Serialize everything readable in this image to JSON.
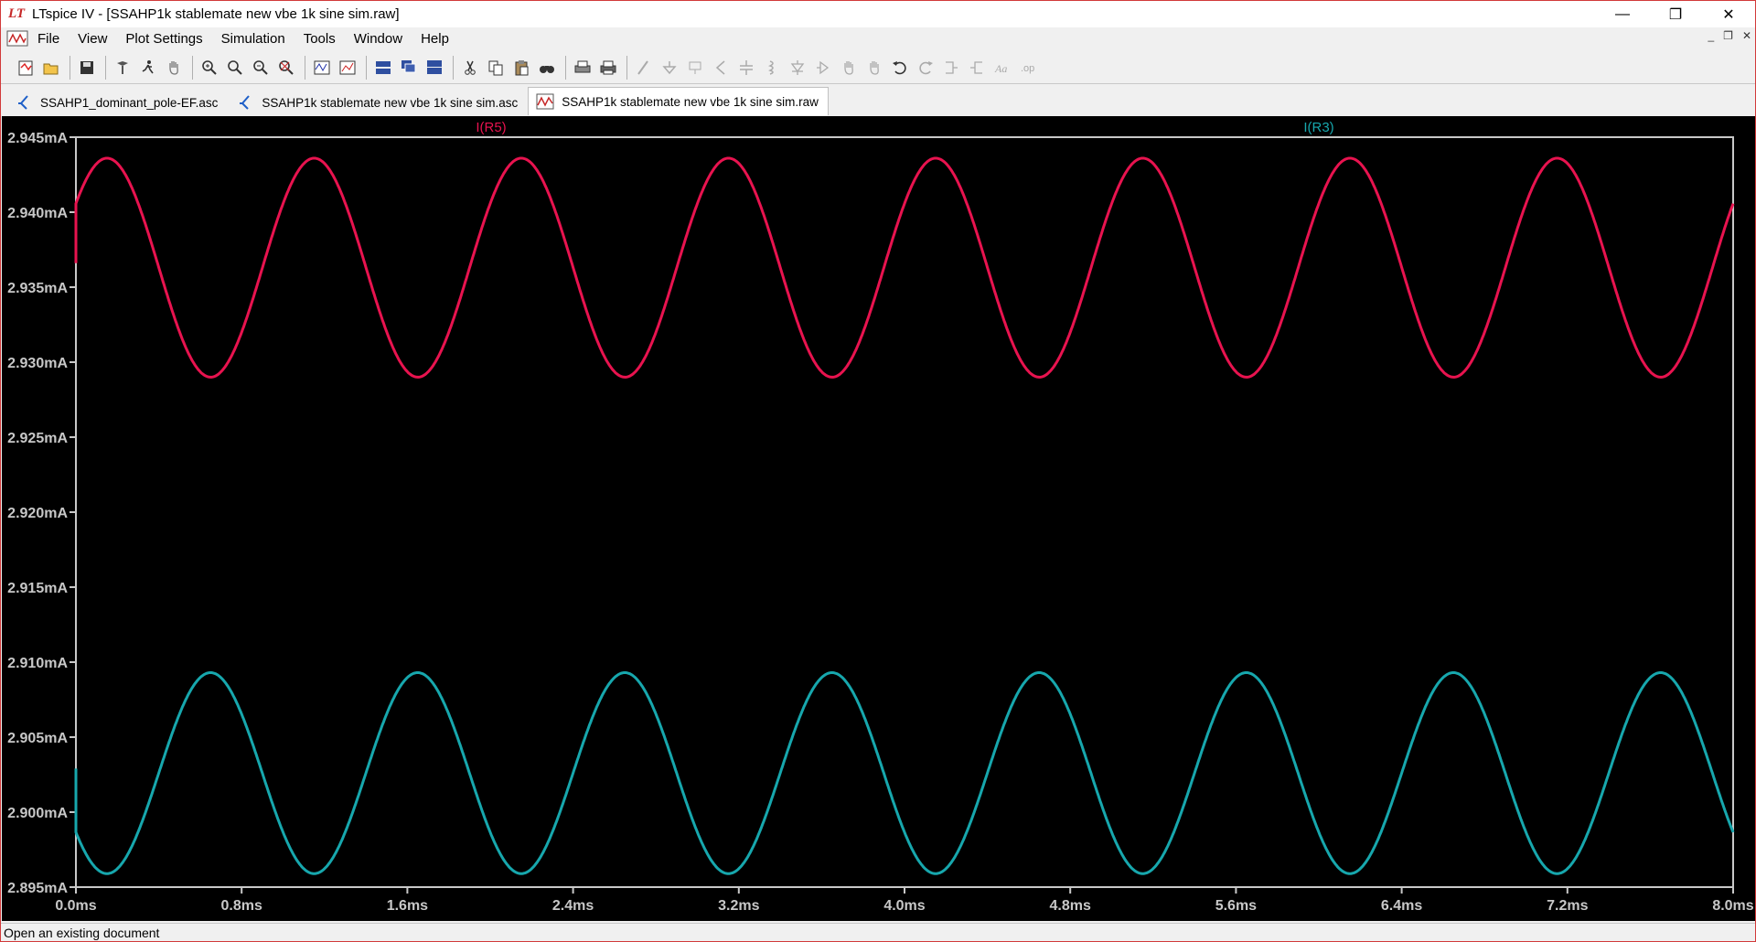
{
  "window": {
    "title": "LTspice IV - [SSAHP1k stablemate new vbe 1k sine sim.raw]",
    "app_logo_text": "LT",
    "minimize": "—",
    "maximize": "❐",
    "close": "✕"
  },
  "menu": {
    "items": [
      "File",
      "View",
      "Plot Settings",
      "Simulation",
      "Tools",
      "Window",
      "Help"
    ],
    "mdi_minimize": "_",
    "mdi_restore": "❐",
    "mdi_close": "✕"
  },
  "toolbar": {
    "icons": [
      "open-schematic-icon",
      "open-file-icon",
      "save-icon",
      "control-panel-icon",
      "run-icon",
      "pan-icon",
      "zoom-in-icon",
      "zoom-area-icon",
      "zoom-out-icon",
      "zoom-fit-icon",
      "autorange-icon",
      "add-trace-icon",
      "tile-horizontal-icon",
      "cascade-icon",
      "tile-windows-icon",
      "cut-icon",
      "copy-icon",
      "paste-icon",
      "find-icon",
      "print-preview-icon",
      "print-icon",
      "wire-icon",
      "ground-icon",
      "label-icon",
      "resistor-icon",
      "capacitor-icon",
      "inductor-icon",
      "diode-icon",
      "component-icon",
      "move-icon",
      "drag-icon",
      "undo-icon",
      "redo-icon",
      "rotate-icon",
      "mirror-icon",
      "text-icon",
      "spice-directive-icon"
    ]
  },
  "tabs": [
    {
      "label": "SSAHP1_dominant_pole-EF.asc",
      "icon": "schematic-icon",
      "active": false
    },
    {
      "label": "SSAHP1k stablemate new vbe 1k sine sim.asc",
      "icon": "schematic-icon",
      "active": false
    },
    {
      "label": "SSAHP1k stablemate new vbe 1k sine sim.raw",
      "icon": "waveform-icon",
      "active": true
    }
  ],
  "status": {
    "text": "Open an existing document"
  },
  "colors": {
    "plot_bg": "#000000",
    "axis": "#c8c8c8",
    "trace_r5": "#e8134f",
    "trace_r3": "#17a7ad"
  },
  "chart_data": {
    "type": "line",
    "title": "",
    "xlabel": "",
    "ylabel": "",
    "xlim": [
      0,
      8.0
    ],
    "ylim": [
      2.895,
      2.945
    ],
    "x_unit": "ms",
    "y_unit": "mA",
    "x_ticks": [
      "0.0ms",
      "0.8ms",
      "1.6ms",
      "2.4ms",
      "3.2ms",
      "4.0ms",
      "4.8ms",
      "5.6ms",
      "6.4ms",
      "7.2ms",
      "8.0ms"
    ],
    "y_ticks": [
      "2.945mA",
      "2.940mA",
      "2.935mA",
      "2.930mA",
      "2.925mA",
      "2.920mA",
      "2.915mA",
      "2.910mA",
      "2.905mA",
      "2.900mA",
      "2.895mA"
    ],
    "grid": false,
    "series": [
      {
        "name": "I(R5)",
        "color": "#e8134f",
        "frequency_khz": 1,
        "offset": 2.9363,
        "amplitude": 0.0073,
        "initial_value": 2.9366,
        "sample_x": [
          0.0,
          0.15,
          0.4,
          0.65,
          0.9,
          1.15,
          1.4,
          1.65,
          1.9,
          2.15,
          2.4,
          2.65,
          2.9,
          3.15,
          3.4,
          3.65,
          3.9,
          4.15,
          4.4,
          4.65,
          4.9,
          5.15,
          5.4,
          5.65,
          5.9,
          6.15,
          6.4,
          6.65,
          6.9,
          7.15,
          7.4,
          7.65,
          7.9,
          8.0
        ],
        "sample_y": [
          2.9415,
          2.9437,
          2.9364,
          2.929,
          2.9364,
          2.9437,
          2.9364,
          2.929,
          2.9364,
          2.9437,
          2.9364,
          2.929,
          2.9364,
          2.9437,
          2.9364,
          2.9289,
          2.9364,
          2.9437,
          2.9364,
          2.9289,
          2.9364,
          2.9437,
          2.9364,
          2.9289,
          2.9364,
          2.9437,
          2.9364,
          2.9289,
          2.9364,
          2.9436,
          2.9363,
          2.9289,
          2.9363,
          2.9412
        ]
      },
      {
        "name": "I(R3)",
        "color": "#17a7ad",
        "frequency_khz": 1,
        "offset": 2.9026,
        "amplitude": 0.0067,
        "initial_value": 2.9029,
        "sample_x": [
          0.0,
          0.4,
          0.65,
          0.9,
          1.15,
          1.4,
          1.65,
          1.9,
          2.15,
          2.4,
          2.65,
          2.9,
          3.15,
          3.4,
          3.65,
          3.9,
          4.15,
          4.4,
          4.65,
          4.9,
          5.15,
          5.4,
          5.65,
          5.9,
          6.15,
          6.4,
          6.65,
          6.9,
          7.15,
          7.4,
          7.65,
          7.9,
          8.0
        ],
        "sample_y": [
          2.8975,
          2.9093,
          2.9026,
          2.8959,
          2.9026,
          2.9093,
          2.9026,
          2.8959,
          2.9026,
          2.9093,
          2.9026,
          2.8958,
          2.9026,
          2.9092,
          2.9026,
          2.8958,
          2.9026,
          2.9092,
          2.9025,
          2.8958,
          2.9025,
          2.9092,
          2.9025,
          2.8957,
          2.9025,
          2.9091,
          2.9025,
          2.8957,
          2.9025,
          2.9091,
          2.9025,
          2.8957,
          2.8975
        ]
      }
    ]
  }
}
